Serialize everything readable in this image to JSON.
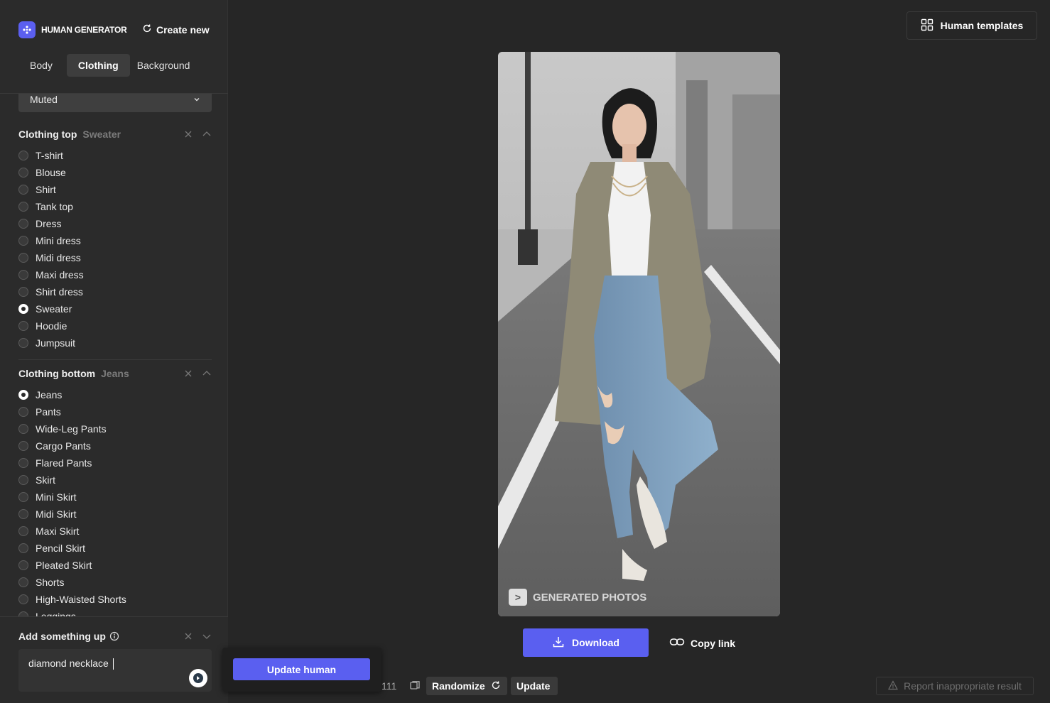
{
  "brand": {
    "name": "HUMAN GENERATOR",
    "create_new": "Create new"
  },
  "tabs": [
    {
      "label": "Body",
      "active": false
    },
    {
      "label": "Clothing",
      "active": true
    },
    {
      "label": "Background",
      "active": false
    }
  ],
  "dropdown": {
    "value": "Muted"
  },
  "clothing_top": {
    "title": "Clothing top",
    "selected": "Sweater",
    "options": [
      "T-shirt",
      "Blouse",
      "Shirt",
      "Tank top",
      "Dress",
      "Mini dress",
      "Midi dress",
      "Maxi dress",
      "Shirt dress",
      "Sweater",
      "Hoodie",
      "Jumpsuit"
    ]
  },
  "clothing_bottom": {
    "title": "Clothing bottom",
    "selected": "Jeans",
    "options": [
      "Jeans",
      "Pants",
      "Wide-Leg Pants",
      "Cargo Pants",
      "Flared Pants",
      "Skirt",
      "Mini Skirt",
      "Midi Skirt",
      "Maxi Skirt",
      "Pencil Skirt",
      "Pleated Skirt",
      "Shorts",
      "High-Waisted Shorts",
      "Leggings"
    ]
  },
  "add_something": {
    "title": "Add something up",
    "value": "diamond necklace"
  },
  "update_human": "Update human",
  "human_templates": "Human templates",
  "watermark": "GENERATED PHOTOS",
  "download": "Download",
  "copy_link": "Copy link",
  "seed_fragment": "111",
  "randomize": "Randomize",
  "update": "Update",
  "report": "Report inappropriate result",
  "colors": {
    "accent": "#5a5ff0",
    "sidebar": "#2b2b2b",
    "background": "#262626"
  },
  "icons": [
    "sparkle-logo-icon",
    "refresh-icon",
    "chevron-down-icon",
    "close-icon",
    "chevron-up-icon",
    "info-icon",
    "enhance-icon",
    "grid-icon",
    "download-icon",
    "link-icon",
    "copy-icon",
    "warning-icon"
  ]
}
